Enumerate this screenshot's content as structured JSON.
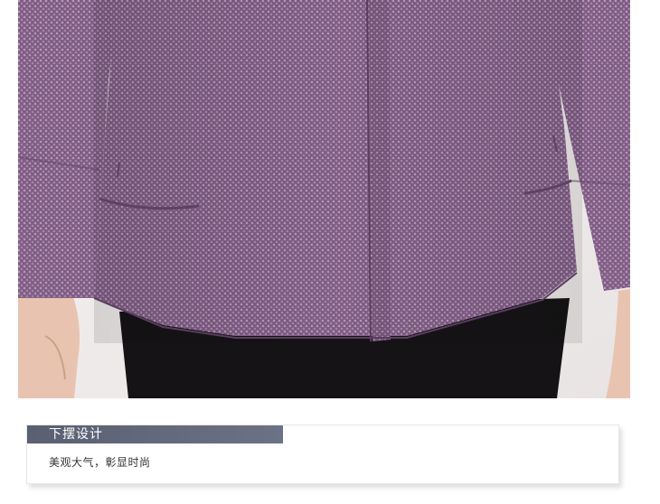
{
  "section": {
    "title": "下摆设计",
    "description": "美观大气，彰显时尚"
  },
  "colors": {
    "header_bar": "#5e6477",
    "jacket": "#8c6a8c",
    "pants": "#141214",
    "skin": "#e8c2ad",
    "card_border": "#e6e6e6"
  }
}
